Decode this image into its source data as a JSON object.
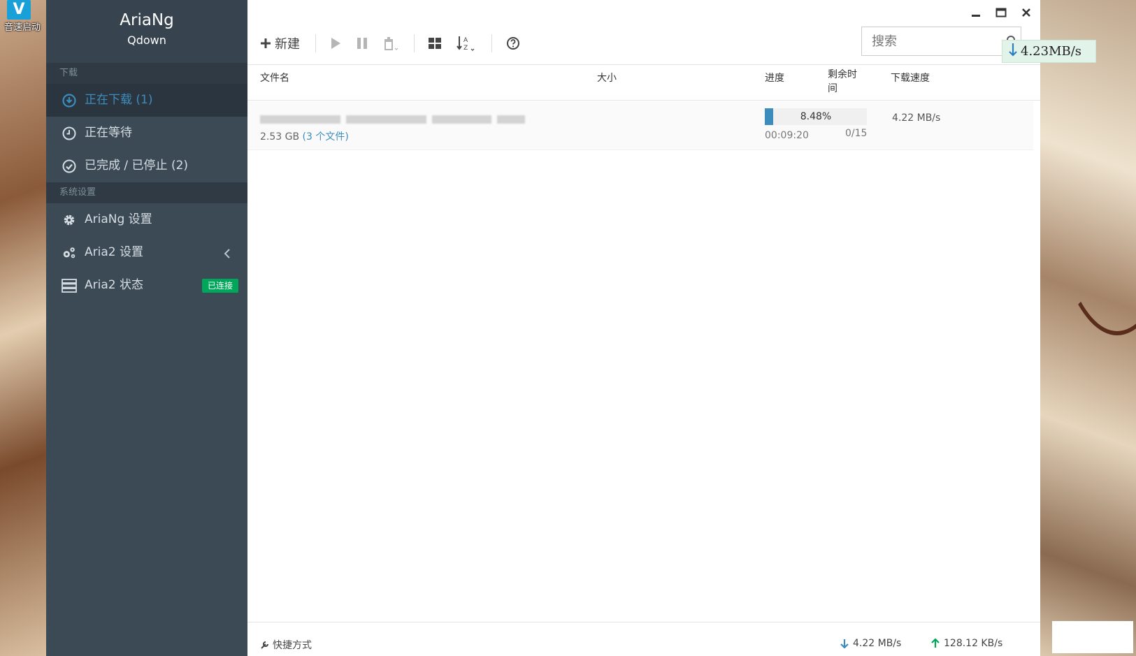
{
  "desktop": {
    "icon_label": "音速启动"
  },
  "sidebar": {
    "app_title": "AriaNg",
    "app_subtitle": "Qdown",
    "section_download": "下载",
    "section_settings": "系统设置",
    "items": [
      {
        "label": "正在下载 (1)",
        "icon": "download-circle-icon",
        "active": true
      },
      {
        "label": "正在等待",
        "icon": "clock-icon"
      },
      {
        "label": "已完成 / 已停止 (2)",
        "icon": "check-circle-icon"
      },
      {
        "label": "AriaNg 设置",
        "icon": "gear-icon"
      },
      {
        "label": "Aria2 设置",
        "icon": "gears-icon"
      },
      {
        "label": "Aria2 状态",
        "icon": "server-icon",
        "badge": "已连接"
      }
    ]
  },
  "toolbar": {
    "new_label": "新建",
    "search_placeholder": "搜索"
  },
  "speed_float": {
    "value": "4.23MB/s"
  },
  "table": {
    "headers": {
      "name": "文件名",
      "size": "大小",
      "progress": "进度",
      "remaining": "剩余时间",
      "speed": "下载速度"
    },
    "rows": [
      {
        "size": "2.53 GB",
        "files": "(3 个文件)",
        "progress_text": "8.48%",
        "progress_value": 8.48,
        "eta": "00:09:20",
        "connections": "0/15",
        "speed": "4.22 MB/s"
      }
    ]
  },
  "footer": {
    "shortcut": "快捷方式",
    "download_speed": "4.22 MB/s",
    "upload_speed": "128.12 KB/s"
  },
  "colors": {
    "accent": "#3c8dbc",
    "sidebar_bg": "#3c4a56",
    "badge_green": "#00a65a",
    "upload_green": "#00a65a"
  }
}
